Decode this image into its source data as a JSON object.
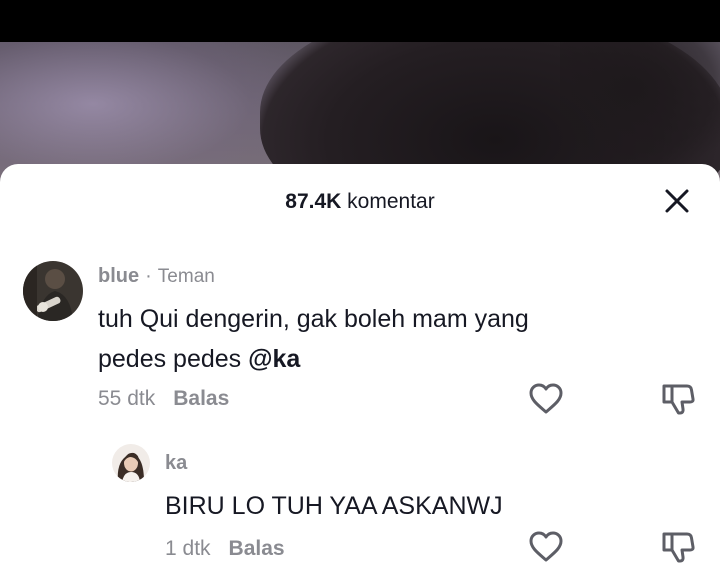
{
  "header": {
    "count": "87.4K",
    "label": "komentar"
  },
  "comments": [
    {
      "author": "blue",
      "separator": "·",
      "tag": "Teman",
      "text_part1": "tuh Qui dengerin, gak boleh mam yang",
      "text_part2": "pedes pedes ",
      "mention": "@ka",
      "time": "55 dtk",
      "reply_label": "Balas"
    }
  ],
  "replies": [
    {
      "author": "ka",
      "text": "BIRU LO TUH YAA ASKANWJ",
      "time": "1 dtk",
      "reply_label": "Balas"
    }
  ],
  "icons": {
    "close": "close-icon",
    "like": "heart-outline-icon",
    "dislike": "thumbs-down-icon"
  },
  "colors": {
    "sheet_background": "#ffffff",
    "primary_text": "#161823",
    "secondary_text": "#8a8b91"
  }
}
